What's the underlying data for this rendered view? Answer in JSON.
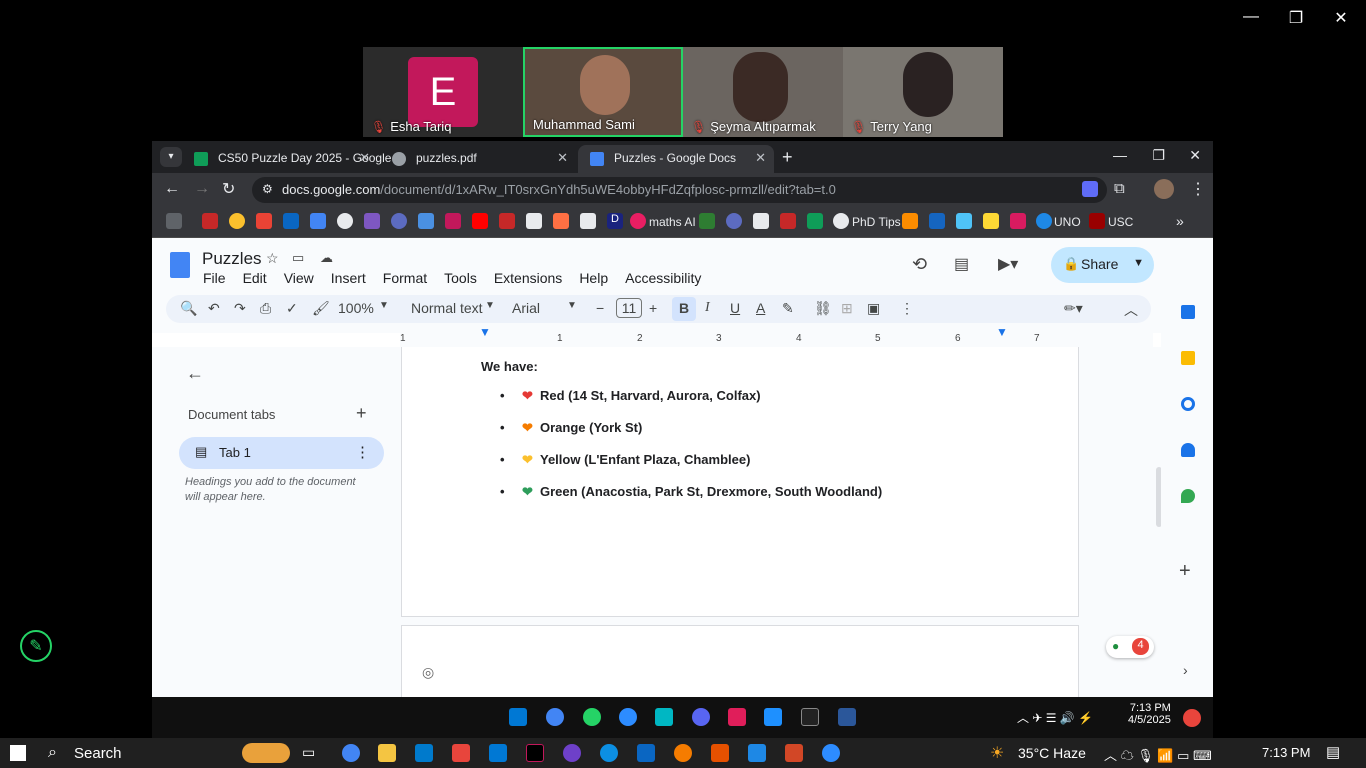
{
  "meeting": {
    "participants": [
      {
        "name": "Esha Tariq",
        "initial": "E",
        "muted": true
      },
      {
        "name": "Muhammad Sami",
        "muted": false
      },
      {
        "name": "Şeyma Altıparmak",
        "muted": true
      },
      {
        "name": "Terry Yang",
        "muted": true
      }
    ]
  },
  "browser": {
    "tabs": [
      {
        "label": "CS50 Puzzle Day 2025 - Google",
        "color": "#0f9d58"
      },
      {
        "label": "puzzles.pdf",
        "color": "#9aa0a6"
      },
      {
        "label": "Puzzles - Google Docs",
        "color": "#4285f4"
      }
    ],
    "url_host": "docs.google.com",
    "url_path": "/document/d/1xARw_IT0srxGnYdh5uWE4obbyHFdZqfplosc-prmzll/edit?tab=t.0",
    "bookmarks": [
      "maths AI",
      "PhD Tips",
      "UNO",
      "USC"
    ]
  },
  "doc": {
    "title": "Puzzles",
    "menu": [
      "File",
      "Edit",
      "View",
      "Insert",
      "Format",
      "Tools",
      "Extensions",
      "Help",
      "Accessibility"
    ],
    "share_label": "Share",
    "toolbar": {
      "zoom": "100%",
      "style": "Normal text",
      "font": "Arial",
      "font_size": "11"
    },
    "ruler": [
      "1",
      "1",
      "2",
      "3",
      "4",
      "5",
      "6",
      "7"
    ],
    "sidebar": {
      "heading": "Document tabs",
      "tab_label": "Tab 1",
      "hint": "Headings you add to the document will appear here."
    },
    "body": {
      "intro": "We have:",
      "items": [
        {
          "heart": "❤",
          "color": "#e53935",
          "text": "Red (14 St, Harvard, Aurora, Colfax)"
        },
        {
          "heart": "❤",
          "color": "#f57c00",
          "text": "Orange (York St)"
        },
        {
          "heart": "❤",
          "color": "#fbc02d",
          "text": "Yellow (L'Enfant Plaza, Chamblee)"
        },
        {
          "heart": "❤",
          "color": "#2e9d5b",
          "text": "Green (Anacostia, Park St, Drexmore, South Woodland)"
        }
      ]
    },
    "badge_count": "4"
  },
  "taskbar": {
    "search_label": "Search",
    "weather": "35°C Haze",
    "time": "7:13 PM",
    "tray_time": "7:13 PM",
    "tray_date": "4/5/2025"
  }
}
